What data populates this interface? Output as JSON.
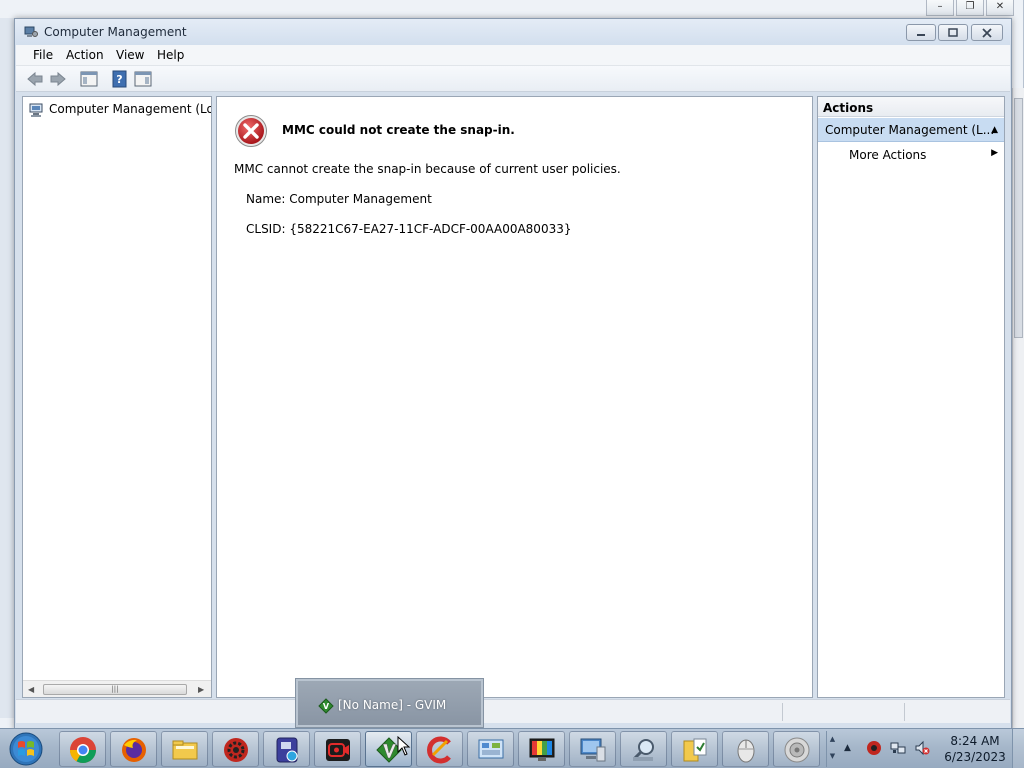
{
  "window": {
    "title": "Computer Management"
  },
  "menubar": {
    "items": [
      {
        "label": "File"
      },
      {
        "label": "Action"
      },
      {
        "label": "View"
      },
      {
        "label": "Help"
      }
    ]
  },
  "tree": {
    "root_label": "Computer Management (Local"
  },
  "content": {
    "error_title": "MMC could not create the snap-in.",
    "error_message": "MMC cannot create the snap-in because of current user policies.",
    "name_line": "Name: Computer Management",
    "clsid_line": "CLSID: {58221C67-EA27-11CF-ADCF-00AA00A80033}"
  },
  "actions": {
    "header": "Actions",
    "group_label": "Computer Management (L...",
    "more_actions": "More Actions"
  },
  "taskbar": {
    "thumbnail_label": "[No Name] - GVIM",
    "clock_time": "8:24 AM",
    "clock_date": "6/23/2023",
    "apps": [
      "chrome-icon",
      "firefox-icon",
      "file-explorer-icon",
      "settings-gear-icon",
      "remote-app-icon",
      "screen-recorder-icon",
      "gvim-icon",
      "ccleaner-icon",
      "control-panel-icon",
      "color-monitor-icon",
      "computer-icon",
      "search-magnifier-icon",
      "folder-check-icon",
      "mouse-icon",
      "speaker-icon"
    ]
  },
  "colors": {
    "accent": "#c8dcf2",
    "error_red": "#c8262c"
  }
}
